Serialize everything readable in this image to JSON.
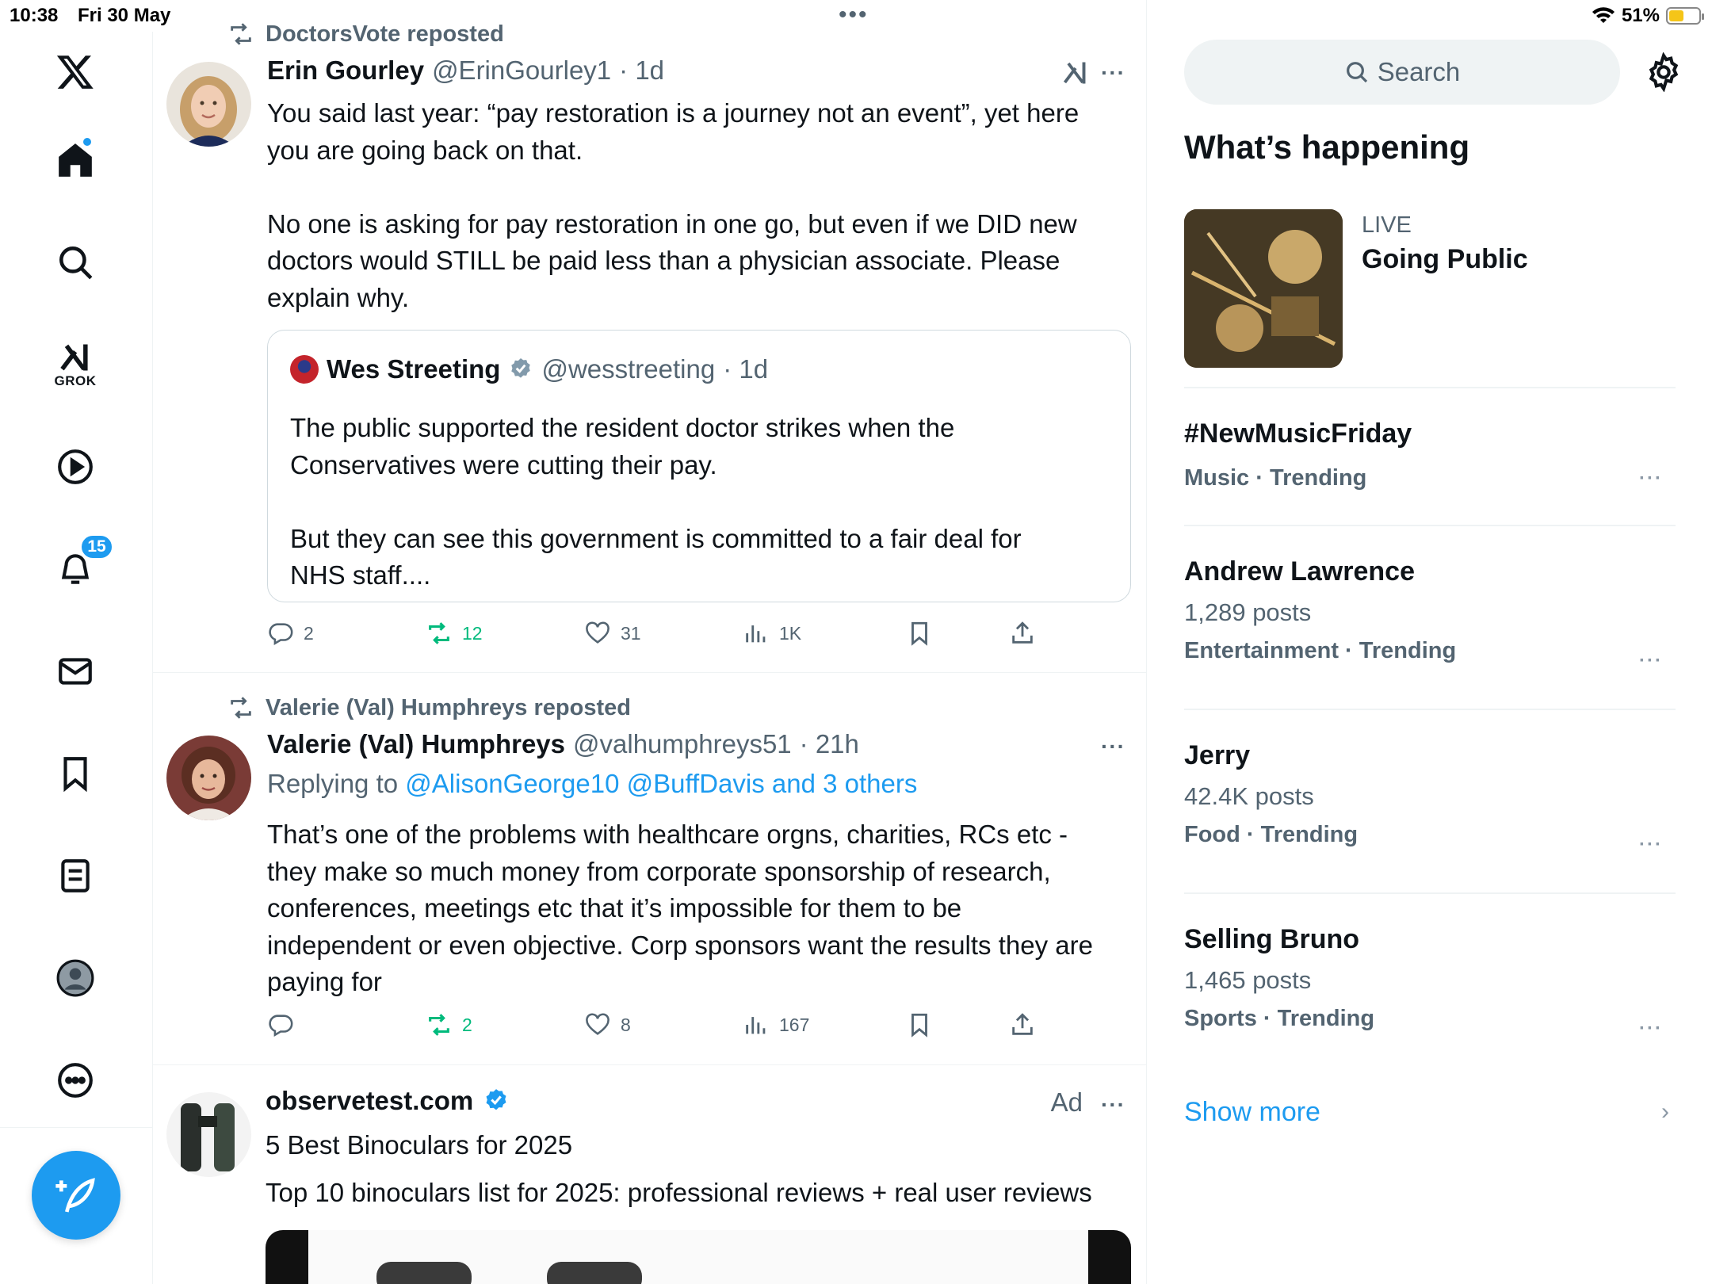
{
  "status_bar": {
    "time": "10:38",
    "date": "Fri 30 May",
    "battery": "51%",
    "battery_level": 0.51
  },
  "nav": {
    "grok_label": "GROK",
    "notifications_badge": "15"
  },
  "posts": [
    {
      "repost_by": "DoctorsVote reposted",
      "author_name": "Erin Gourley",
      "author_handle": "@ErinGourley1",
      "time": "· 1d",
      "text": "You said last year: “pay restoration is a journey not an event”, yet here\nyou are going back on that.\n\nNo one is asking for pay restoration in one go, but even if we DID new\ndoctors would STILL be paid less than a physician associate. Please\nexplain why.",
      "quote": {
        "author_name": "Wes Streeting",
        "author_handle": "@wesstreeting",
        "time": "· 1d",
        "text": "The public supported the resident doctor strikes when the\nConservatives were cutting their pay.\n\nBut they can see this government is committed to a fair deal for\nNHS staff...."
      },
      "replies": "2",
      "reposts": "12",
      "likes": "31",
      "views": "1K"
    },
    {
      "repost_by": "Valerie (Val) Humphreys reposted",
      "author_name": "Valerie (Val) Humphreys",
      "author_handle": "@valhumphreys51",
      "time": "· 21h",
      "replying_prefix": "Replying to ",
      "replying_to": "@AlisonGeorge10 @BuffDavis and 3 others",
      "text": "That’s one of the problems with healthcare orgns, charities, RCs etc -\nthey make so much money from corporate sponsorship of research,\nconferences, meetings etc that it’s impossible for them to be\nindependent or even objective. Corp sponsors want the results they are\npaying for",
      "replies": "",
      "reposts": "2",
      "likes": "8",
      "views": "167"
    }
  ],
  "ad": {
    "advertiser": "observetest.com",
    "label": "Ad",
    "headline": "5 Best Binoculars for 2025",
    "description": "Top 10 binoculars list for 2025: professional reviews + real user reviews"
  },
  "right": {
    "search_placeholder": "Search",
    "section_title": "What’s happening",
    "live": {
      "label": "LIVE",
      "title": "Going Public"
    },
    "trends": [
      {
        "name": "#NewMusicFriday",
        "posts": "",
        "category": "Music · Trending"
      },
      {
        "name": "Andrew Lawrence",
        "posts": "1,289 posts",
        "category": "Entertainment · Trending"
      },
      {
        "name": "Jerry",
        "posts": "42.4K posts",
        "category": "Food · Trending"
      },
      {
        "name": "Selling Bruno",
        "posts": "1,465 posts",
        "category": "Sports · Trending"
      }
    ],
    "show_more": "Show more"
  },
  "colors": {
    "accent": "#1d9bf0",
    "repost_green": "#00ba7c",
    "secondary_text": "#536471"
  },
  "icons": [
    "x-logo-icon",
    "home-icon",
    "search-icon",
    "grok-icon",
    "video-icon",
    "notifications-icon",
    "messages-icon",
    "bookmarks-icon",
    "lists-icon",
    "profile-icon",
    "more-icon",
    "compose-icon",
    "repost-icon",
    "reply-icon",
    "like-icon",
    "views-icon",
    "bookmark-icon",
    "share-icon",
    "verified-icon",
    "settings-icon",
    "grok-analyze-icon"
  ]
}
